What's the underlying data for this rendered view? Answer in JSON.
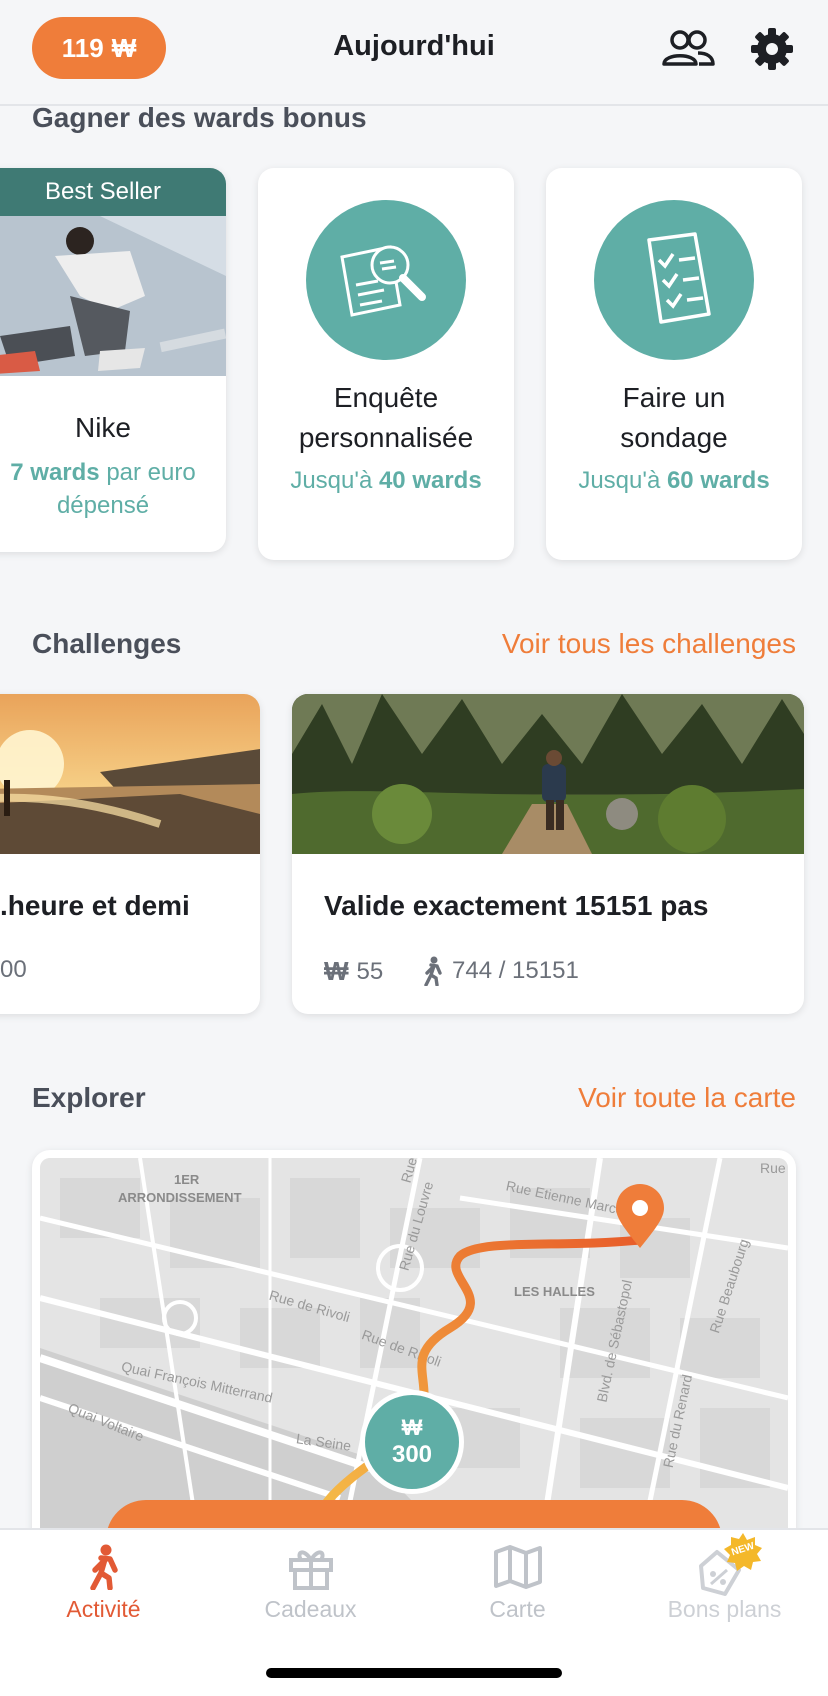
{
  "header": {
    "balance": "119",
    "currency_symbol": "₩",
    "title": "Aujourd'hui"
  },
  "bonus": {
    "section_title": "Gagner des wards bonus",
    "cards": [
      {
        "ribbon": "Best Seller",
        "title": "Nike",
        "sub_bold": "7 wards",
        "sub_rest": " par euro",
        "sub_line2": "dépensé"
      },
      {
        "title_line1": "Enquête",
        "title_line2": "personnalisée",
        "sub_prefix": "Jusqu'à ",
        "sub_bold": "40 wards"
      },
      {
        "title_line1": "Faire un",
        "title_line2": "sondage",
        "sub_prefix": "Jusqu'à ",
        "sub_bold": "60 wards"
      }
    ]
  },
  "challenges": {
    "section_title": "Challenges",
    "link": "Voir tous les challenges",
    "cards": [
      {
        "title": ".heure et demi",
        "meta": "00"
      },
      {
        "title": "Valide exactement 15151 pas",
        "reward": "55",
        "progress": "744 / 15151"
      }
    ]
  },
  "explorer": {
    "section_title": "Explorer",
    "link": "Voir toute la carte",
    "map_labels": {
      "arrondissement_1": "1ER",
      "arrondissement_2": "ARRONDISSEMENT",
      "les_halles": "LES HALLES",
      "rue_rivoli_1": "Rue de Rivoli",
      "rue_rivoli_2": "Rue de Rivoli",
      "quai_mitterrand": "Quai François Mitterrand",
      "quai_voltaire": "Quai Voltaire",
      "rue_louvre": "Rue du Louvre",
      "rue_etienne_marcel": "Rue Etienne Marcel",
      "blvd_sebastopol": "Blvd. de Sébastopol",
      "rue_renard": "Rue du Renard",
      "rue_beaubourg": "Rue Beaubourg",
      "rue_top": "Rue",
      "rue_top_right": "Rue",
      "la_seine": "La Seine"
    },
    "marker_symbol": "₩",
    "marker_value": "300"
  },
  "nav": {
    "items": [
      {
        "label": "Activité",
        "active": true
      },
      {
        "label": "Cadeaux",
        "active": false
      },
      {
        "label": "Carte",
        "active": false
      },
      {
        "label": "Bons plans",
        "active": false,
        "badge": "NEW"
      }
    ]
  },
  "colors": {
    "accent": "#ef7d3a",
    "teal": "#5faea6",
    "dark_teal": "#3f7a74"
  }
}
